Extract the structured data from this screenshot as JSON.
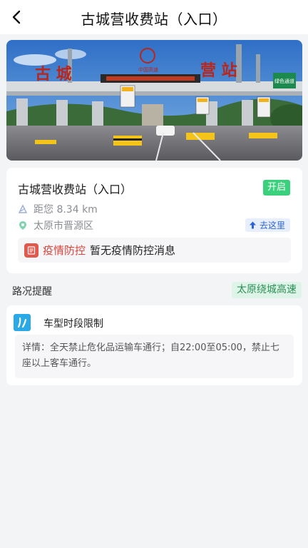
{
  "header": {
    "back_icon": "chevron-left-icon",
    "title": "古城营收费站（入口）"
  },
  "hero": {
    "sign_left": "古 城",
    "sign_right": "营 站",
    "plaza_sign": "中国高速",
    "lane_labels": [
      "ETC专用",
      "人工收费",
      "人工收费",
      "ETC专用"
    ],
    "right_sign": "绿色通道"
  },
  "station": {
    "name": "古城营收费站（入口）",
    "status": "开启",
    "status_color": "#3ad07c",
    "distance": "距您 8.34 km",
    "address": "太原市晋源区",
    "goto_label": "去这里",
    "epidemic_title": "疫情防控",
    "epidemic_message": "暂无疫情防控消息"
  },
  "road": {
    "section_title": "路况提醒",
    "highway_badge": "太原绕城高速",
    "alert": {
      "title": "车型时段限制",
      "detail": "详情：全天禁止危化品运输车通行；自22:00至05:00，禁止七座以上客车通行。"
    }
  }
}
